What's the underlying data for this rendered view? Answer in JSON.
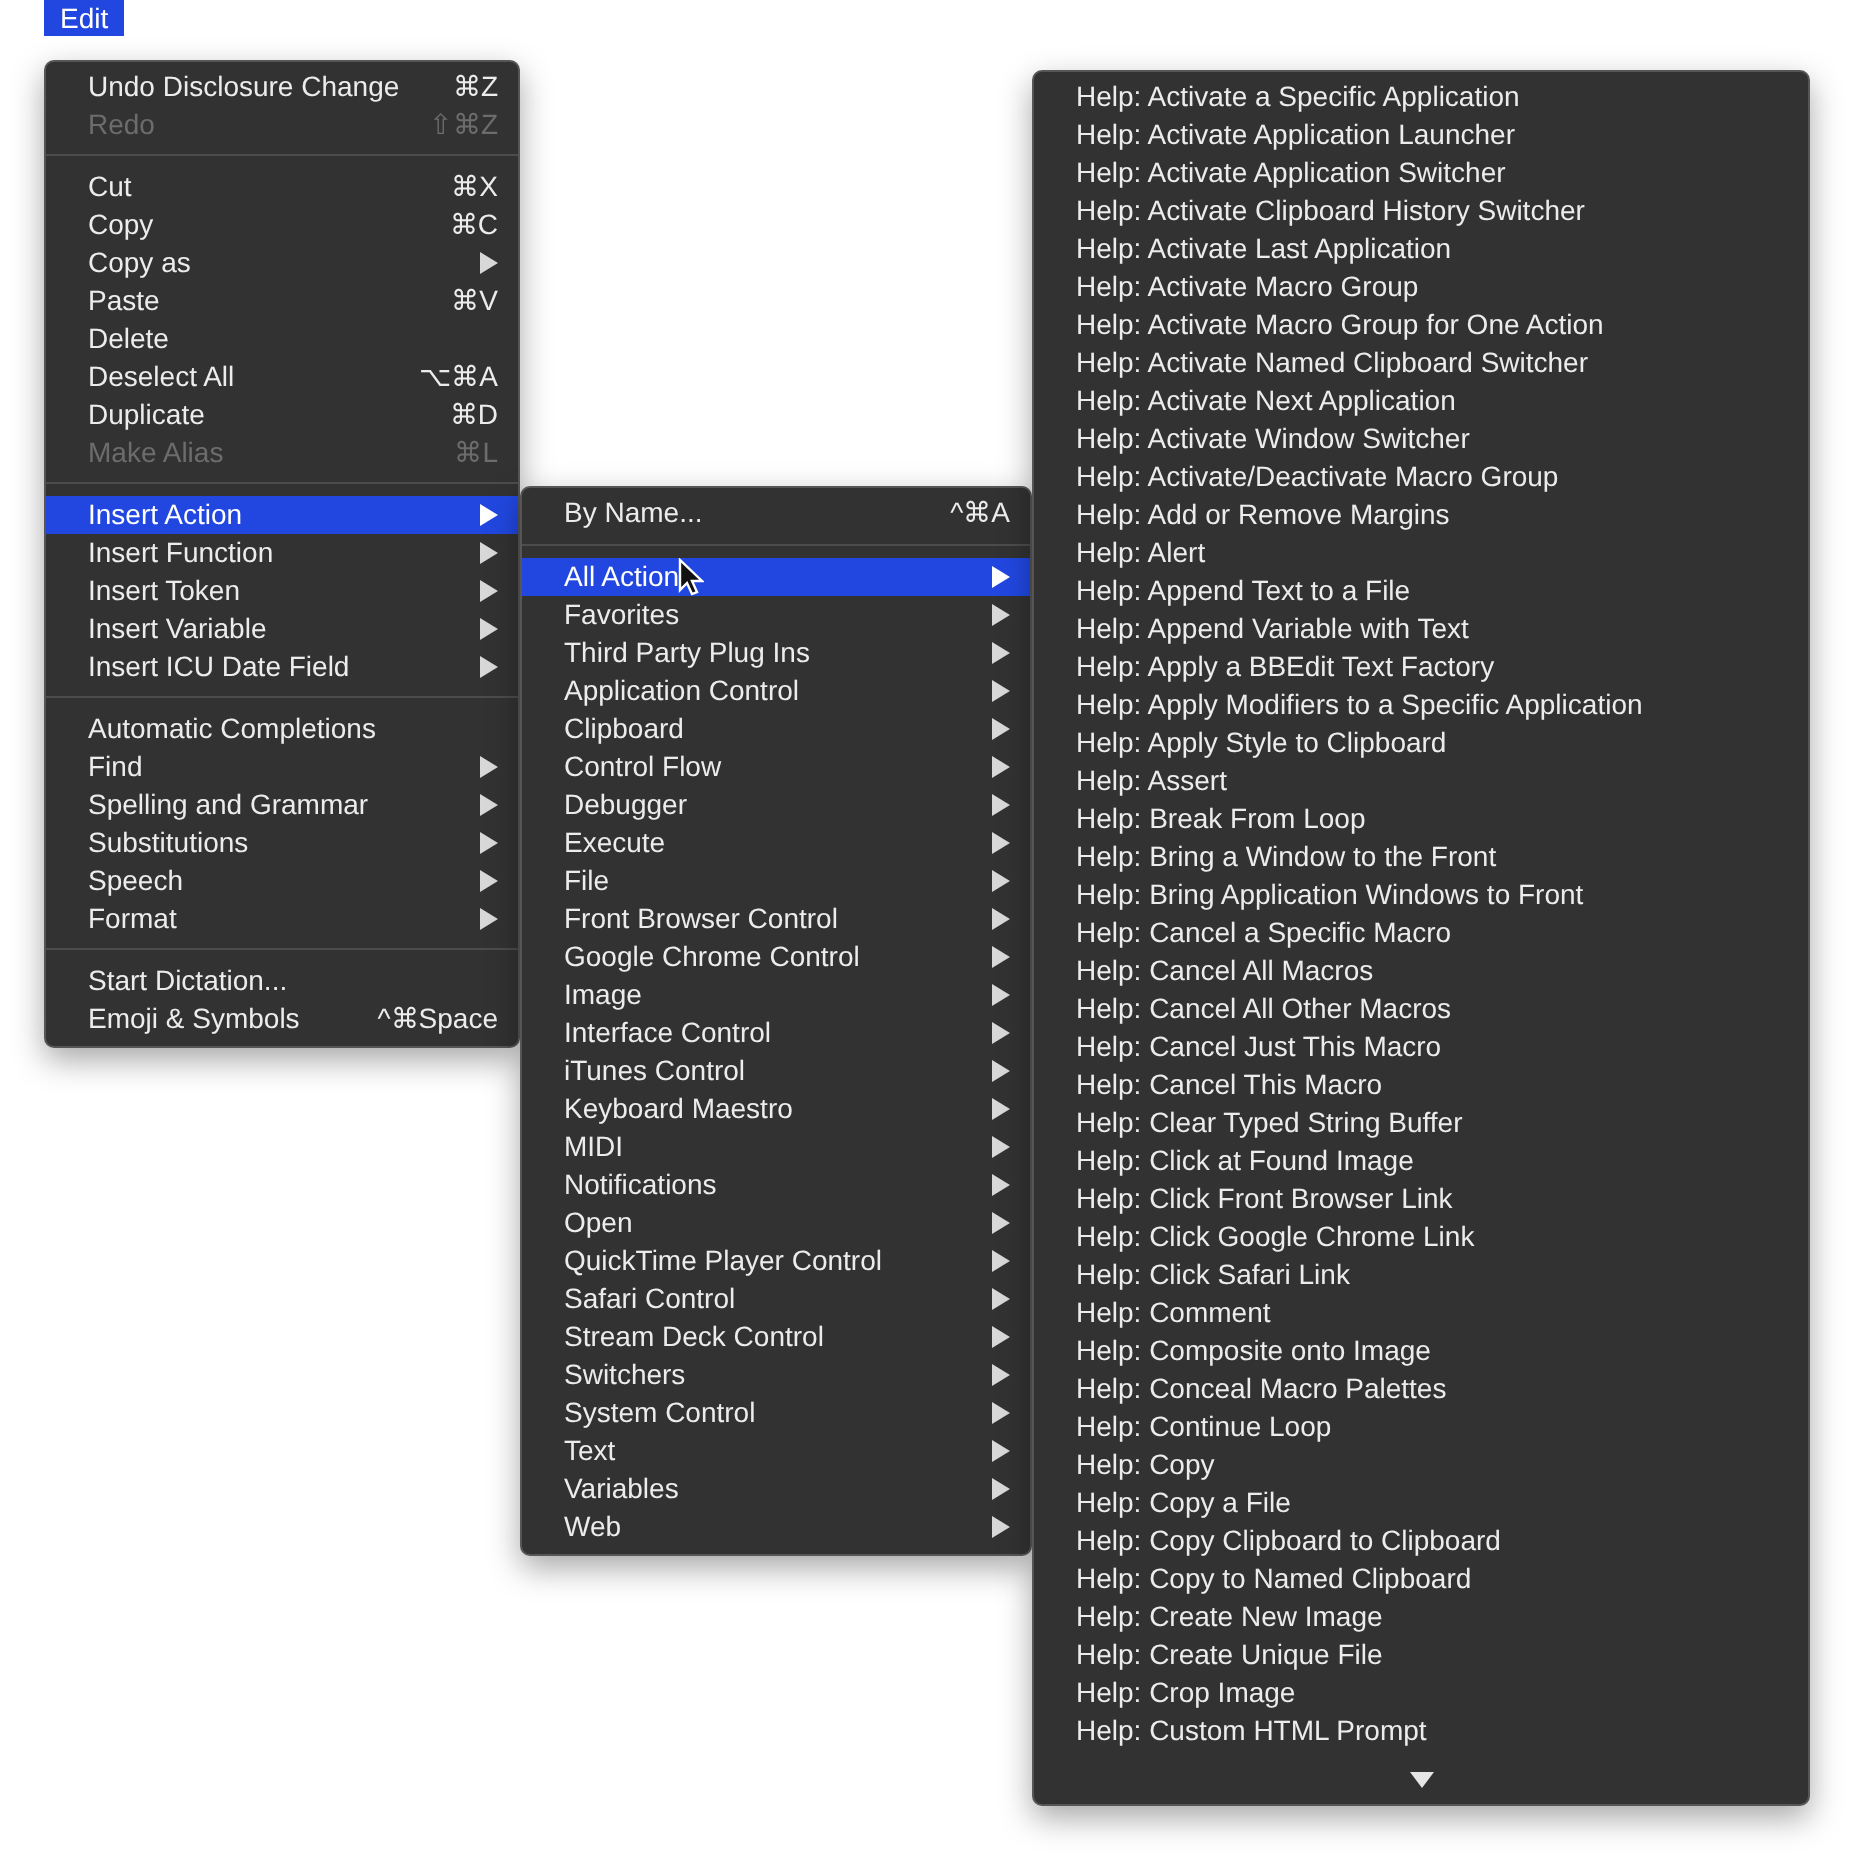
{
  "menu_bar": {
    "title": "Edit",
    "selected": true
  },
  "edit_menu": {
    "sections": [
      [
        {
          "label": "Undo Disclosure Change",
          "shortcut": "⌘Z",
          "disabled": false,
          "submenu": false,
          "selected": false
        },
        {
          "label": "Redo",
          "shortcut": "⇧⌘Z",
          "disabled": true,
          "submenu": false,
          "selected": false
        }
      ],
      [
        {
          "label": "Cut",
          "shortcut": "⌘X",
          "disabled": false,
          "submenu": false,
          "selected": false
        },
        {
          "label": "Copy",
          "shortcut": "⌘C",
          "disabled": false,
          "submenu": false,
          "selected": false
        },
        {
          "label": "Copy as",
          "disabled": false,
          "submenu": true,
          "selected": false
        },
        {
          "label": "Paste",
          "shortcut": "⌘V",
          "disabled": false,
          "submenu": false,
          "selected": false
        },
        {
          "label": "Delete",
          "disabled": false,
          "submenu": false,
          "selected": false
        },
        {
          "label": "Deselect All",
          "shortcut": "⌥⌘A",
          "disabled": false,
          "submenu": false,
          "selected": false
        },
        {
          "label": "Duplicate",
          "shortcut": "⌘D",
          "disabled": false,
          "submenu": false,
          "selected": false
        },
        {
          "label": "Make Alias",
          "shortcut": "⌘L",
          "disabled": true,
          "submenu": false,
          "selected": false
        }
      ],
      [
        {
          "label": "Insert Action",
          "disabled": false,
          "submenu": true,
          "selected": true
        },
        {
          "label": "Insert Function",
          "disabled": false,
          "submenu": true,
          "selected": false
        },
        {
          "label": "Insert Token",
          "disabled": false,
          "submenu": true,
          "selected": false
        },
        {
          "label": "Insert Variable",
          "disabled": false,
          "submenu": true,
          "selected": false
        },
        {
          "label": "Insert ICU Date Field",
          "disabled": false,
          "submenu": true,
          "selected": false
        }
      ],
      [
        {
          "label": "Automatic Completions",
          "disabled": false,
          "submenu": false,
          "selected": false
        },
        {
          "label": "Find",
          "disabled": false,
          "submenu": true,
          "selected": false
        },
        {
          "label": "Spelling and Grammar",
          "disabled": false,
          "submenu": true,
          "selected": false
        },
        {
          "label": "Substitutions",
          "disabled": false,
          "submenu": true,
          "selected": false
        },
        {
          "label": "Speech",
          "disabled": false,
          "submenu": true,
          "selected": false
        },
        {
          "label": "Format",
          "disabled": false,
          "submenu": true,
          "selected": false
        }
      ],
      [
        {
          "label": "Start Dictation...",
          "disabled": false,
          "submenu": false,
          "selected": false
        },
        {
          "label": "Emoji & Symbols",
          "shortcut": "^⌘Space",
          "disabled": false,
          "submenu": false,
          "selected": false
        }
      ]
    ]
  },
  "insert_action_menu": {
    "sections": [
      [
        {
          "label": "By Name...",
          "shortcut": "^⌘A",
          "disabled": false,
          "submenu": false,
          "selected": false
        }
      ],
      [
        {
          "label": "All Action",
          "disabled": false,
          "submenu": true,
          "selected": true
        },
        {
          "label": "Favorites",
          "disabled": false,
          "submenu": true,
          "selected": false
        },
        {
          "label": "Third Party Plug Ins",
          "disabled": false,
          "submenu": true,
          "selected": false
        },
        {
          "label": "Application Control",
          "disabled": false,
          "submenu": true,
          "selected": false
        },
        {
          "label": "Clipboard",
          "disabled": false,
          "submenu": true,
          "selected": false
        },
        {
          "label": "Control Flow",
          "disabled": false,
          "submenu": true,
          "selected": false
        },
        {
          "label": "Debugger",
          "disabled": false,
          "submenu": true,
          "selected": false
        },
        {
          "label": "Execute",
          "disabled": false,
          "submenu": true,
          "selected": false
        },
        {
          "label": "File",
          "disabled": false,
          "submenu": true,
          "selected": false
        },
        {
          "label": "Front Browser Control",
          "disabled": false,
          "submenu": true,
          "selected": false
        },
        {
          "label": "Google Chrome Control",
          "disabled": false,
          "submenu": true,
          "selected": false
        },
        {
          "label": "Image",
          "disabled": false,
          "submenu": true,
          "selected": false
        },
        {
          "label": "Interface Control",
          "disabled": false,
          "submenu": true,
          "selected": false
        },
        {
          "label": "iTunes Control",
          "disabled": false,
          "submenu": true,
          "selected": false
        },
        {
          "label": "Keyboard Maestro",
          "disabled": false,
          "submenu": true,
          "selected": false
        },
        {
          "label": "MIDI",
          "disabled": false,
          "submenu": true,
          "selected": false
        },
        {
          "label": "Notifications",
          "disabled": false,
          "submenu": true,
          "selected": false
        },
        {
          "label": "Open",
          "disabled": false,
          "submenu": true,
          "selected": false
        },
        {
          "label": "QuickTime Player Control",
          "disabled": false,
          "submenu": true,
          "selected": false
        },
        {
          "label": "Safari Control",
          "disabled": false,
          "submenu": true,
          "selected": false
        },
        {
          "label": "Stream Deck Control",
          "disabled": false,
          "submenu": true,
          "selected": false
        },
        {
          "label": "Switchers",
          "disabled": false,
          "submenu": true,
          "selected": false
        },
        {
          "label": "System Control",
          "disabled": false,
          "submenu": true,
          "selected": false
        },
        {
          "label": "Text",
          "disabled": false,
          "submenu": true,
          "selected": false
        },
        {
          "label": "Variables",
          "disabled": false,
          "submenu": true,
          "selected": false
        },
        {
          "label": "Web",
          "disabled": false,
          "submenu": true,
          "selected": false
        }
      ]
    ]
  },
  "all_actions_menu": {
    "items": [
      {
        "label": "Help: Activate a Specific Application",
        "selected": false
      },
      {
        "label": "Help: Activate Application Launcher",
        "selected": false
      },
      {
        "label": "Help: Activate Application Switcher",
        "selected": false
      },
      {
        "label": "Help: Activate Clipboard History Switcher",
        "selected": false
      },
      {
        "label": "Help: Activate Last Application",
        "selected": false
      },
      {
        "label": "Help: Activate Macro Group",
        "selected": false
      },
      {
        "label": "Help: Activate Macro Group for One Action",
        "selected": false
      },
      {
        "label": "Help: Activate Named Clipboard Switcher",
        "selected": false
      },
      {
        "label": "Help: Activate Next Application",
        "selected": false
      },
      {
        "label": "Help: Activate Window Switcher",
        "selected": false
      },
      {
        "label": "Help: Activate/Deactivate Macro Group",
        "selected": false
      },
      {
        "label": "Help: Add or Remove Margins",
        "selected": false
      },
      {
        "label": "Help: Alert",
        "selected": false
      },
      {
        "label": "Help: Append Text to a File",
        "selected": false
      },
      {
        "label": "Help: Append Variable with Text",
        "selected": false
      },
      {
        "label": "Help: Apply a BBEdit Text Factory",
        "selected": false
      },
      {
        "label": "Help: Apply Modifiers to a Specific Application",
        "selected": false
      },
      {
        "label": "Help: Apply Style to Clipboard",
        "selected": false
      },
      {
        "label": "Help: Assert",
        "selected": false
      },
      {
        "label": "Help: Break From Loop",
        "selected": false
      },
      {
        "label": "Help: Bring a Window to the Front",
        "selected": false
      },
      {
        "label": "Help: Bring Application Windows to Front",
        "selected": false
      },
      {
        "label": "Help: Cancel a Specific Macro",
        "selected": false
      },
      {
        "label": "Help: Cancel All Macros",
        "selected": false
      },
      {
        "label": "Help: Cancel All Other Macros",
        "selected": false
      },
      {
        "label": "Help: Cancel Just This Macro",
        "selected": false
      },
      {
        "label": "Help: Cancel This Macro",
        "selected": false
      },
      {
        "label": "Help: Clear Typed String Buffer",
        "selected": false
      },
      {
        "label": "Help: Click at Found Image",
        "selected": false
      },
      {
        "label": "Help: Click Front Browser Link",
        "selected": false
      },
      {
        "label": "Help: Click Google Chrome Link",
        "selected": false
      },
      {
        "label": "Help: Click Safari Link",
        "selected": false
      },
      {
        "label": "Help: Comment",
        "selected": false
      },
      {
        "label": "Help: Composite onto Image",
        "selected": false
      },
      {
        "label": "Help: Conceal Macro Palettes",
        "selected": false
      },
      {
        "label": "Help: Continue Loop",
        "selected": false
      },
      {
        "label": "Help: Copy",
        "selected": false
      },
      {
        "label": "Help: Copy a File",
        "selected": false
      },
      {
        "label": "Help: Copy Clipboard to Clipboard",
        "selected": false
      },
      {
        "label": "Help: Copy to Named Clipboard",
        "selected": false
      },
      {
        "label": "Help: Create New Image",
        "selected": false
      },
      {
        "label": "Help: Create Unique File",
        "selected": false
      },
      {
        "label": "Help: Crop Image",
        "selected": false
      },
      {
        "label": "Help: Custom HTML Prompt",
        "selected": false
      }
    ]
  }
}
